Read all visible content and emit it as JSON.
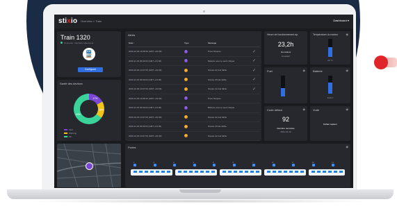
{
  "header": {
    "logo_pre": "sti",
    "logo_x": "x",
    "logo_post": "io",
    "breadcrumb": "Overview  >  Train",
    "dashboard_label": "Dashboard ▾"
  },
  "train": {
    "title": "Train 1320",
    "status": "Connecté · Dernière mise à jour",
    "configure_label": "Configurer"
  },
  "health": {
    "title": "Santé des devices",
    "chart_data": {
      "type": "pie",
      "labels": [
        "Alert",
        "Warning",
        "Ok"
      ],
      "values": [
        17,
        18,
        65
      ],
      "colors": [
        "#7a46d6",
        "#f0c419",
        "#3ad49a"
      ]
    },
    "slice_labels": [
      "17%",
      "18%",
      "65%"
    ],
    "legend": [
      "Alert",
      "Warning",
      "Ok"
    ]
  },
  "alerts": {
    "title": "Alerts",
    "columns": [
      "Date ↑",
      "Type",
      "Message"
    ],
    "rows": [
      {
        "date": "2020-12-06 19:48:46 (GMT +01:00)",
        "type": "ⓘ",
        "color": "#7a46d6",
        "message": "Porte bloquée",
        "ack": "✓"
      },
      {
        "date": "2020-11-29 06:09:03 (GMT +01:00)",
        "type": "ⓘ",
        "color": "#7a46d6",
        "message": "Batterie sous le seuil critique",
        "ack": "✓"
      },
      {
        "date": "2020-10-29 14:07:00 (GMT +01:00)",
        "type": "⚠",
        "color": "#f0a019",
        "message": "Niveau de fuel faible",
        "ack": "✓"
      },
      {
        "date": "2020-11-29 06:09:03 (GMT +01:00)",
        "type": "⚠",
        "color": "#f0a019",
        "message": "Niveau d'huile faible",
        "ack": "✓"
      },
      {
        "date": "2020-10-06 14:07:00 (GMT +01:00)",
        "type": "⚠",
        "color": "#f0a019",
        "message": "Niveau de fuel faible",
        "ack": "✓"
      },
      {
        "date": "2020-12-06 19:48:46 (GMT +01:00)",
        "type": "ⓘ",
        "color": "#7a46d6",
        "message": "Porte bloquée",
        "ack": ""
      },
      {
        "date": "2020-11-29 06:09:03 (GMT +01:00)",
        "type": "ⓘ",
        "color": "#7a46d6",
        "message": "Batterie sous le seuil critique",
        "ack": ""
      },
      {
        "date": "2020-10-29 14:07:00 (GMT +01:00)",
        "type": "⚠",
        "color": "#f0a019",
        "message": "Niveau de fuel faible",
        "ack": ""
      },
      {
        "date": "2020-11-29 06:09:03 (GMT +01:00)",
        "type": "⚠",
        "color": "#f0a019",
        "message": "Niveau d'huile faible",
        "ack": ""
      },
      {
        "date": "2020-10-06 14:07:00 (GMT +01:00)",
        "type": "⚠",
        "color": "#f0a019",
        "message": "Niveau de fuel faible",
        "ack": ""
      }
    ]
  },
  "hours": {
    "title": "Heure de fonctionnement ap.",
    "value": "23,2h",
    "sub1": "Ce mois-ci",
    "sub2": "Constant"
  },
  "motor_temp": {
    "title": "Température du moteur",
    "value": "24 °C",
    "level_pct": 55
  },
  "fuel": {
    "title": "Fuel",
    "level_pct": 40
  },
  "battery": {
    "title": "Batterie",
    "value": "24,8 V",
    "level_pct": 60
  },
  "fault": {
    "title": "Code défaut",
    "value": "92",
    "sub1": "Dernière remontée",
    "sub2": "2021-02-10"
  },
  "fault_msg": {
    "title": "Vude",
    "value": "Défaut capteur"
  },
  "doors": {
    "title": "Portes",
    "ticks": [
      "1",
      "2",
      "3",
      "4",
      "5",
      "6",
      "7",
      "8",
      "9",
      "10",
      "11"
    ]
  }
}
